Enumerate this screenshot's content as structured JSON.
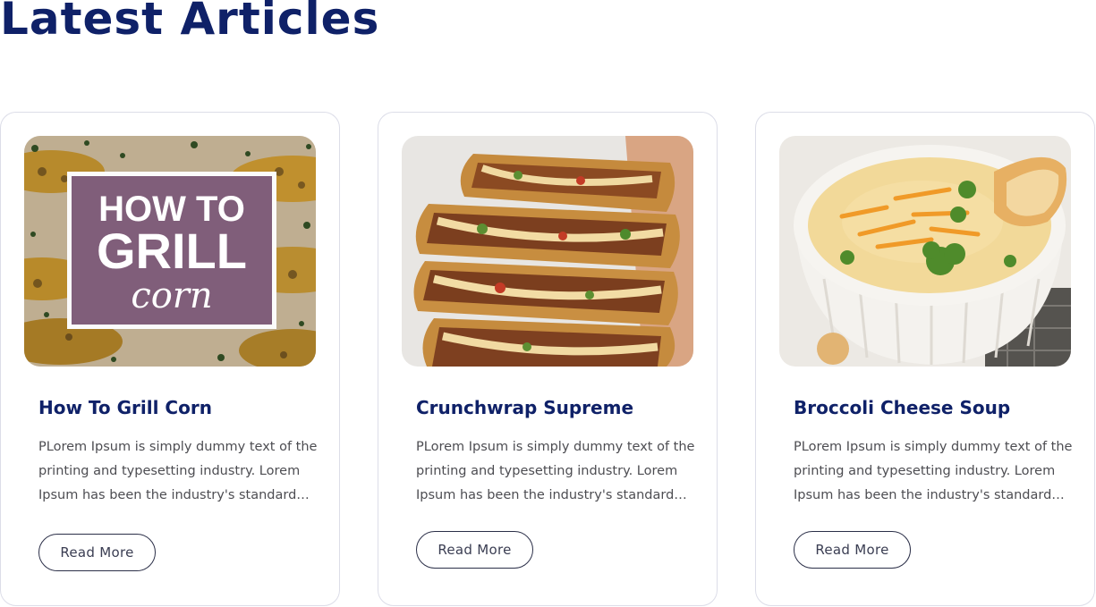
{
  "section": {
    "title": "Latest Articles"
  },
  "articles": [
    {
      "title": "How To Grill Corn",
      "excerpt_lines": [
        "PLorem Ipsum is simply dummy text of the",
        "printing and typesetting industry. Lorem",
        "Ipsum has been the industry's standard…"
      ],
      "button_label": "Read More",
      "image": {
        "description": "grilled-corn-photo",
        "overlay_line1": "HOW TO",
        "overlay_line2": "GRILL",
        "overlay_line3": "corn"
      }
    },
    {
      "title": "Crunchwrap Supreme",
      "excerpt_lines": [
        "PLorem Ipsum is simply dummy text of the",
        "printing and typesetting industry. Lorem",
        "Ipsum has been the industry's standard…"
      ],
      "button_label": "Read More",
      "image": {
        "description": "crunchwrap-stack-photo"
      }
    },
    {
      "title": "Broccoli Cheese Soup",
      "excerpt_lines": [
        "PLorem Ipsum is simply dummy text of the",
        "printing and typesetting industry. Lorem",
        "Ipsum has been the industry's standard…"
      ],
      "button_label": "Read More",
      "image": {
        "description": "broccoli-cheese-soup-photo"
      }
    }
  ],
  "colors": {
    "title": "#0f2168",
    "body_text": "#4d4d52",
    "card_border": "#dcdde8",
    "button_border": "#2b2f48"
  }
}
